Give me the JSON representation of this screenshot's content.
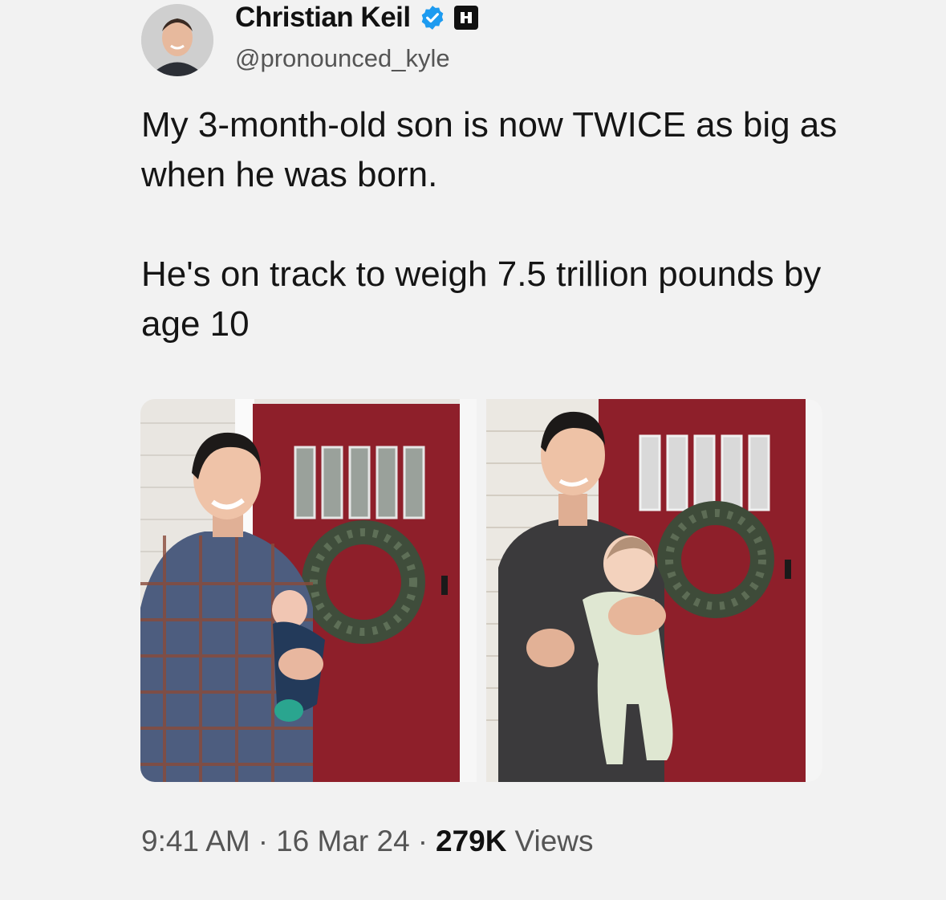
{
  "tweet": {
    "author": {
      "name": "Christian Keil",
      "handle": "@pronounced_kyle",
      "verified_badge_icon": "verified-check-icon",
      "affiliate_badge_icon": "affiliate-badge-icon"
    },
    "text": [
      "My 3-month-old son is now TWICE as big as when he was born.",
      "He's on track to weigh 7.5 trillion pounds by age 10"
    ],
    "media": [
      {
        "icon": "photo-man-plaid-shirt-holding-newborn"
      },
      {
        "icon": "photo-man-tshirt-holding-baby"
      }
    ],
    "meta": {
      "time": "9:41 AM",
      "sep1": "·",
      "date": "16 Mar 24",
      "sep2": "·",
      "views_count": "279K",
      "views_label": "Views"
    }
  },
  "colors": {
    "background": "#f2f2f2",
    "verified_blue": "#1d9bf0",
    "door_red": "#8e1f2a"
  }
}
